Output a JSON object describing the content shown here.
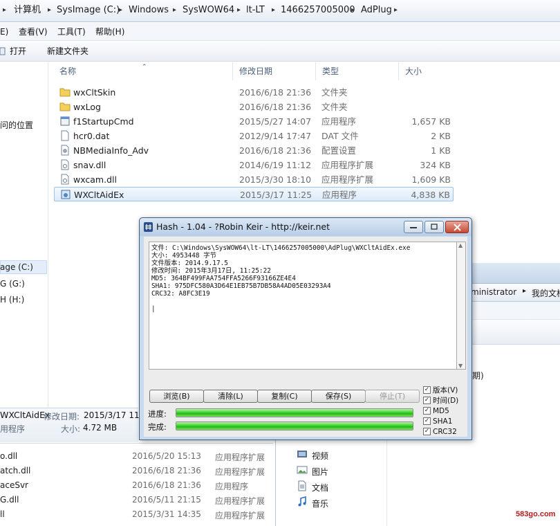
{
  "address": {
    "crumbs": [
      "计算机",
      "SysImage (C:)",
      "Windows",
      "SysWOW64",
      "lt-LT",
      "1466257005000",
      "AdPlug"
    ]
  },
  "menu": {
    "items": [
      "E)",
      "查看(V)",
      "工具(T)",
      "帮助(H)"
    ]
  },
  "toolbar": {
    "open": "打开",
    "new_folder": "新建文件夹"
  },
  "nav": {
    "items": [
      "问的位置",
      "age (C:)",
      "G (G:)",
      "H (H:)"
    ]
  },
  "list": {
    "headers": {
      "name": "名称",
      "date": "修改日期",
      "type": "类型",
      "size": "大小"
    },
    "rows": [
      {
        "name": "wxCltSkin",
        "date": "2016/6/18 21:36",
        "type": "文件夹",
        "size": "",
        "icon": "folder-icon"
      },
      {
        "name": "wxLog",
        "date": "2016/6/18 21:36",
        "type": "文件夹",
        "size": "",
        "icon": "folder-icon"
      },
      {
        "name": "f1StartupCmd",
        "date": "2015/5/27 14:07",
        "type": "应用程序",
        "size": "1,657 KB",
        "icon": "exe-icon"
      },
      {
        "name": "hcr0.dat",
        "date": "2012/9/14 17:47",
        "type": "DAT 文件",
        "size": "2 KB",
        "icon": "file-icon"
      },
      {
        "name": "NBMediaInfo_Adv",
        "date": "2016/6/18 21:36",
        "type": "配置设置",
        "size": "1 KB",
        "icon": "config-icon"
      },
      {
        "name": "snav.dll",
        "date": "2014/6/19 11:12",
        "type": "应用程序扩展",
        "size": "324 KB",
        "icon": "dll-icon"
      },
      {
        "name": "wxcam.dll",
        "date": "2015/3/30 18:10",
        "type": "应用程序扩展",
        "size": "1,609 KB",
        "icon": "dll-icon"
      },
      {
        "name": "WXCltAidEx",
        "date": "2015/3/17 11:25",
        "type": "应用程序",
        "size": "4,838 KB",
        "icon": "exe-icon"
      }
    ]
  },
  "details": {
    "name": "WXCltAidEx",
    "date_label": "修改日期:",
    "date_value": "2015/3/17 11:",
    "type": "用程序",
    "size_label": "大小:",
    "size_value": "4.72 MB"
  },
  "bottom_list": {
    "rows": [
      {
        "name": "o.dll",
        "date": "2016/5/20 15:13",
        "type": "应用程序扩展"
      },
      {
        "name": "atch.dll",
        "date": "2016/6/18 21:36",
        "type": "应用程序扩展"
      },
      {
        "name": "aceSvr",
        "date": "2016/6/18 21:36",
        "type": "应用程序"
      },
      {
        "name": "G.dll",
        "date": "2016/5/11 21:15",
        "type": "应用程序扩展"
      },
      {
        "name": "ll",
        "date": "2015/3/31 14:35",
        "type": "应用程序扩展"
      }
    ]
  },
  "right_window": {
    "crumb1": "ministrator",
    "crumb2": "我的文档",
    "col": "期)",
    "libraries": [
      "视频",
      "图片",
      "文档",
      "音乐"
    ]
  },
  "hash": {
    "title": "Hash - 1.04 - ?Robin Keir - http://keir.net",
    "output": [
      "文件: C:\\Windows\\SysWOW64\\lt-LT\\1466257005000\\AdPlug\\WXCltAidEx.exe",
      "大小: 4953448 字节",
      "文件版本: 2014.9.17.5",
      "修改时间: 2015年3月17日, 11:25:22",
      "MD5: 364BF499FAA754FFA5266F93166ZE4E4",
      "SHA1: 975DFC580A3D64E1EB75B7DB58A4AD05E03293A4",
      "CRC32: A8FC3E19",
      "",
      "|"
    ],
    "buttons": [
      "浏览(B)",
      "清除(L)",
      "复制(C)",
      "保存(S)",
      "停止(T)"
    ],
    "progress_label": "进度:",
    "done_label": "完成:",
    "progress": 1.0,
    "done": 1.0,
    "options": [
      {
        "label": "版本(V)",
        "checked": true
      },
      {
        "label": "时间(D)",
        "checked": true
      },
      {
        "label": "MD5",
        "checked": true
      },
      {
        "label": "SHA1",
        "checked": true
      },
      {
        "label": "CRC32",
        "checked": true
      }
    ]
  },
  "watermark": "583go.com",
  "colors": {
    "progress_green": "#2ec71e",
    "selection": "#dcebfa",
    "title_bar": "#c7d9ec"
  }
}
